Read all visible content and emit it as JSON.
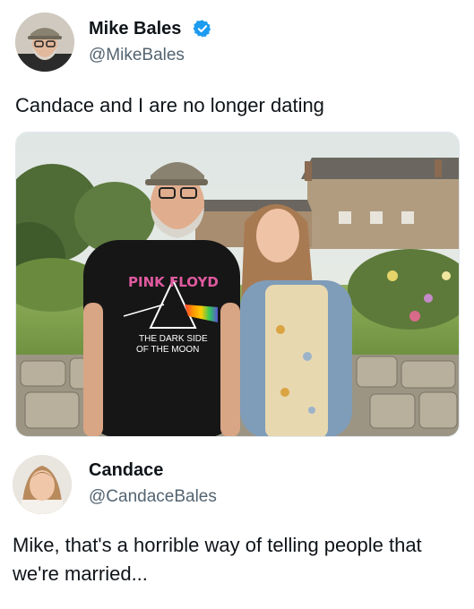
{
  "tweet": {
    "author_name": "Mike Bales",
    "author_handle": "@MikeBales",
    "verified_icon": "verified-badge-icon",
    "text": "Candace and I are no longer dating",
    "photo": {
      "shirt_line1": "PINK FLOYD",
      "shirt_line2": "THE DARK SIDE",
      "shirt_line3": "OF THE MOON"
    }
  },
  "reply": {
    "author_name": "Candace",
    "author_handle": "@CandaceBales",
    "text": "Mike, that's a horrible way of telling people that we're married..."
  },
  "colors": {
    "text_primary": "#0f1419",
    "text_secondary": "#536471",
    "verified_blue": "#1d9bf0"
  }
}
